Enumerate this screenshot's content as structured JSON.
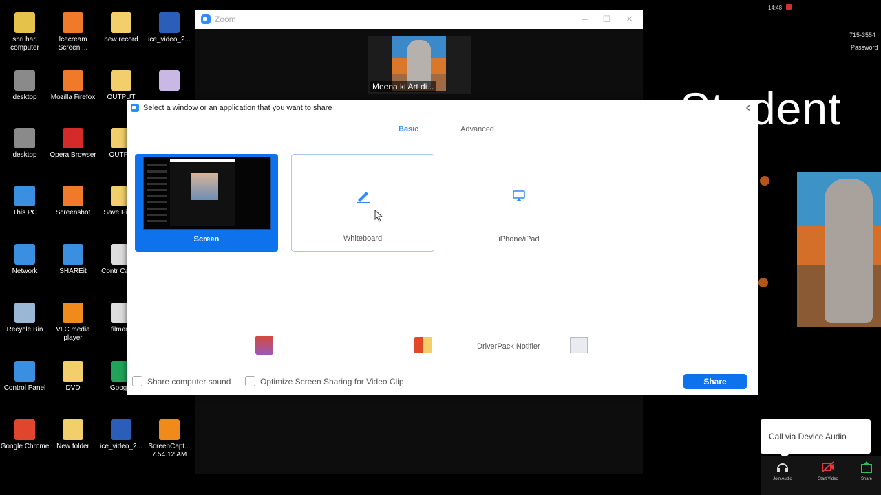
{
  "desktop_icons": [
    {
      "label": "shri hari computer",
      "color": "#e5c34a",
      "col": 0,
      "row": 0
    },
    {
      "label": "Icecream Screen ...",
      "color": "#f07a2a",
      "col": 1,
      "row": 0
    },
    {
      "label": "new record",
      "color": "#f2cf6b",
      "col": 2,
      "row": 0
    },
    {
      "label": "ice_video_2...",
      "color": "#2b5eb8",
      "col": 3,
      "row": 0
    },
    {
      "label": "desktop",
      "color": "#8a8a8a",
      "col": 0,
      "row": 1
    },
    {
      "label": "Mozilla Firefox",
      "color": "#f07a2a",
      "col": 1,
      "row": 1
    },
    {
      "label": "OUTPUT",
      "color": "#f2cf6b",
      "col": 2,
      "row": 1
    },
    {
      "label": "",
      "color": "#c9b7e6",
      "col": 3,
      "row": 1
    },
    {
      "label": "desktop",
      "color": "#8a8a8a",
      "col": 0,
      "row": 2
    },
    {
      "label": "Opera Browser",
      "color": "#d42a2a",
      "col": 1,
      "row": 2
    },
    {
      "label": "OUTPU",
      "color": "#f2cf6b",
      "col": 2,
      "row": 2
    },
    {
      "label": "This PC",
      "color": "#3a8fe0",
      "col": 0,
      "row": 3
    },
    {
      "label": "Screenshot",
      "color": "#f07a2a",
      "col": 1,
      "row": 3
    },
    {
      "label": "Save Pictur",
      "color": "#f2cf6b",
      "col": 2,
      "row": 3
    },
    {
      "label": "Network",
      "color": "#3a8fe0",
      "col": 0,
      "row": 4
    },
    {
      "label": "SHAREit",
      "color": "#3a8fe0",
      "col": 1,
      "row": 4
    },
    {
      "label": "Contr CamSt",
      "color": "#dddddd",
      "col": 2,
      "row": 4
    },
    {
      "label": "Recycle Bin",
      "color": "#9ab7d6",
      "col": 0,
      "row": 5
    },
    {
      "label": "VLC media player",
      "color": "#f08a1a",
      "col": 1,
      "row": 5
    },
    {
      "label": "filmora",
      "color": "#dddddd",
      "col": 2,
      "row": 5
    },
    {
      "label": "Control Panel",
      "color": "#3a8fe0",
      "col": 0,
      "row": 6
    },
    {
      "label": "DVD",
      "color": "#f2cf6b",
      "col": 1,
      "row": 6
    },
    {
      "label": "Google",
      "color": "#22a35a",
      "col": 2,
      "row": 6
    },
    {
      "label": "Google Chrome",
      "color": "#e0452e",
      "col": 0,
      "row": 7
    },
    {
      "label": "New folder",
      "color": "#f2cf6b",
      "col": 1,
      "row": 7
    },
    {
      "label": "ice_video_2...",
      "color": "#2b5eb8",
      "col": 2,
      "row": 7
    },
    {
      "label": "ScreenCapt... 7.54.12 AM",
      "color": "#f08a1a",
      "col": 3,
      "row": 7
    }
  ],
  "zoom_window": {
    "title": "Zoom",
    "controls": [
      "–",
      "☐",
      "✕"
    ],
    "participant_name": "Meena ki Art di..."
  },
  "share_dialog": {
    "header": "Select a window or an application that you want to share",
    "close": "✕",
    "tabs": {
      "basic": "Basic",
      "advanced": "Advanced"
    },
    "options": {
      "screen": "Screen",
      "whiteboard": "Whiteboard",
      "ipad": "iPhone/iPad"
    },
    "apps": {
      "driverpack": "DriverPack Notifier"
    },
    "checkboxes": {
      "sound": "Share computer sound",
      "optimize": "Optimize Screen Sharing for Video Clip"
    },
    "share_button": "Share",
    "accent": "#0e72ed"
  },
  "right_panel": {
    "status_time": "14:48",
    "phone": "715-3554",
    "password_label": "Password",
    "big_text": "Student",
    "audio_popup": "Call via Device Audio",
    "toolbar": {
      "join_audio": "Join Audio",
      "start_video": "Start Video",
      "share": "Share"
    }
  }
}
